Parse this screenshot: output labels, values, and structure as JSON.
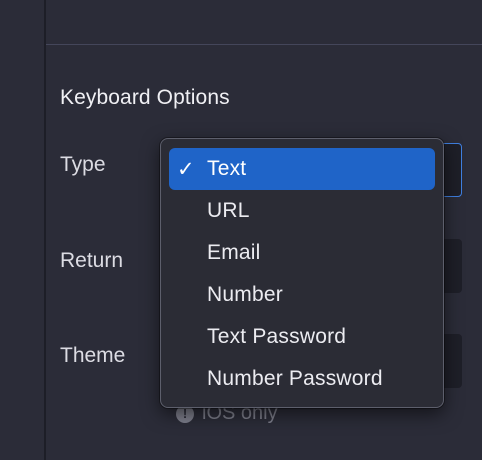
{
  "section": {
    "title": "Keyboard Options"
  },
  "fields": {
    "type_label": "Type",
    "return_label": "Return",
    "theme_label": "Theme"
  },
  "hint": {
    "text": "iOS only",
    "icon": "info-icon"
  },
  "dropdown": {
    "selected": "Text",
    "check_glyph": "✓",
    "options": [
      {
        "label": "Text",
        "selected": true
      },
      {
        "label": "URL",
        "selected": false
      },
      {
        "label": "Email",
        "selected": false
      },
      {
        "label": "Number",
        "selected": false
      },
      {
        "label": "Text Password",
        "selected": false
      },
      {
        "label": "Number Password",
        "selected": false
      }
    ]
  },
  "colors": {
    "background": "#2b2c38",
    "control_background": "#1e1f28",
    "focus_border": "#3f7fe0",
    "selected_item": "#1f64c8",
    "hint_text": "#7d7e8b"
  }
}
